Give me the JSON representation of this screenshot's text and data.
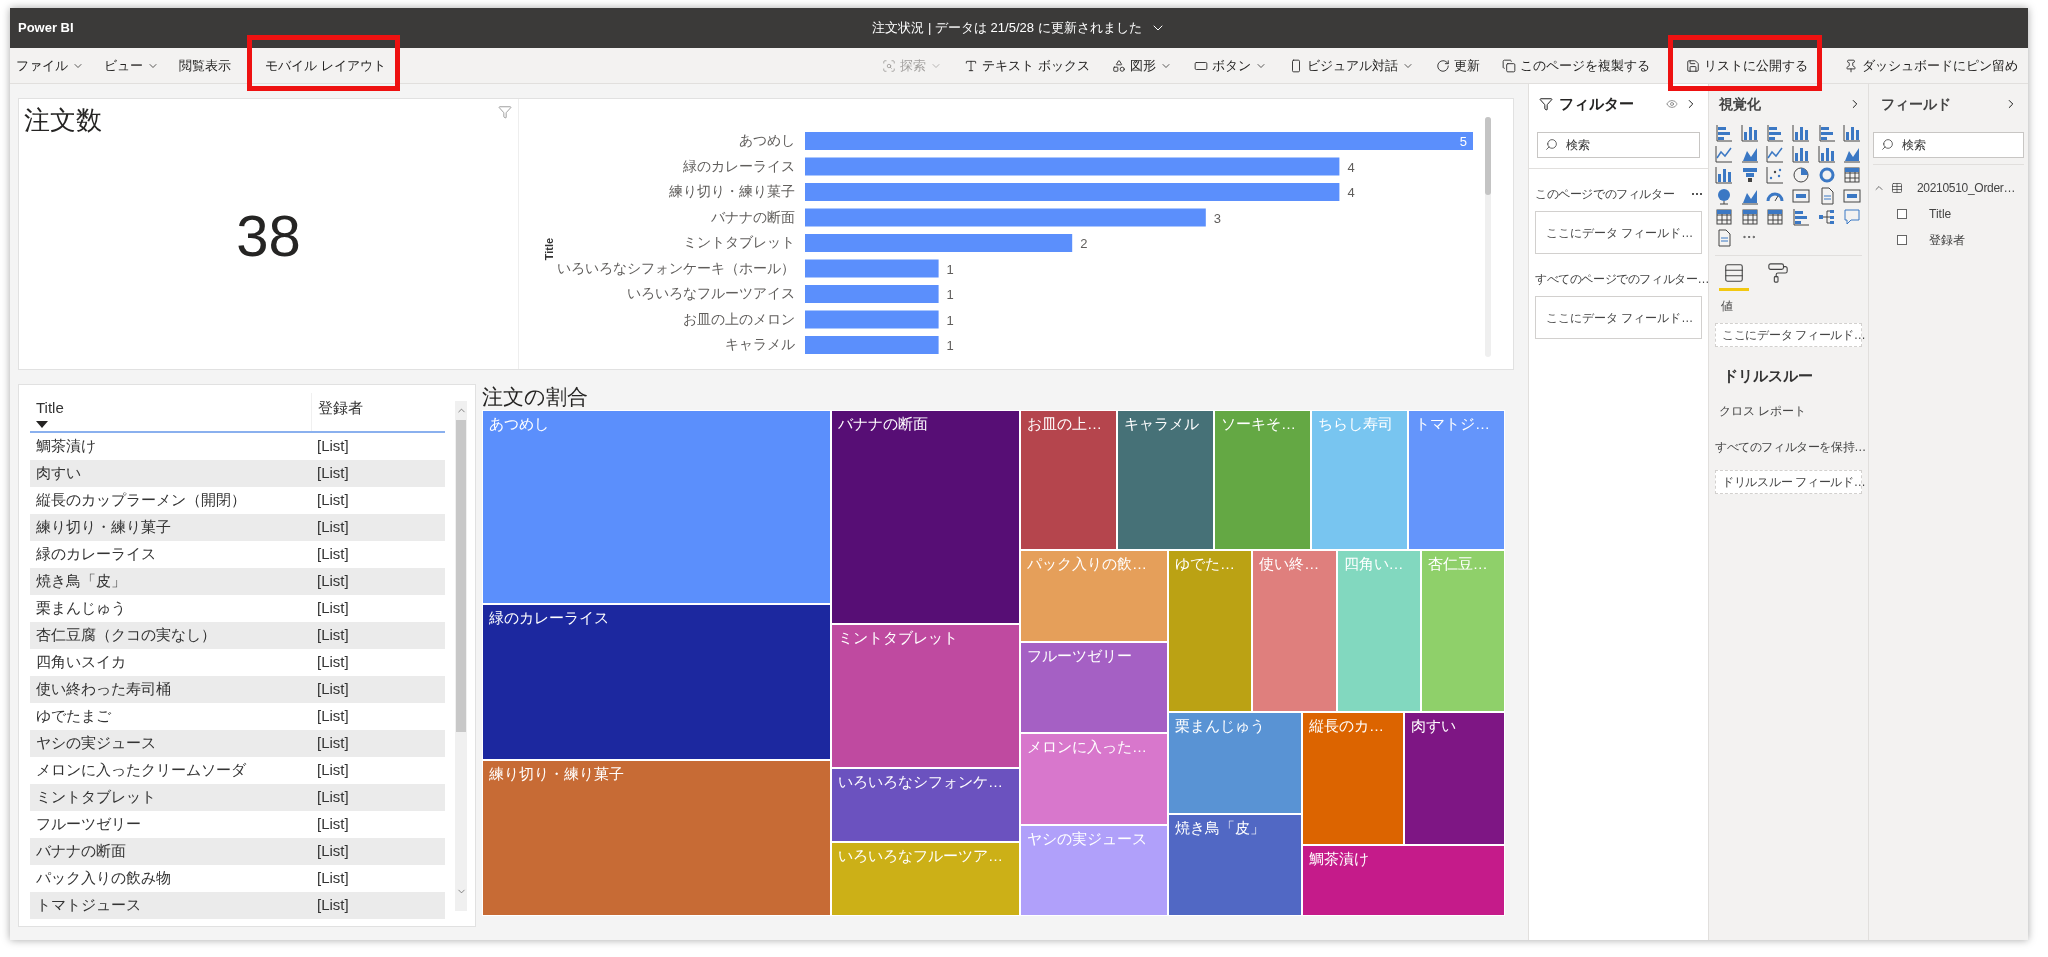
{
  "window": {
    "app_name": "Power BI",
    "title": "注文状況 | データは 21/5/28 に更新されました"
  },
  "menu": {
    "left": [
      {
        "label": "ファイル",
        "dropdown": true,
        "disabled": false,
        "highlighted": false
      },
      {
        "label": "ビュー",
        "dropdown": true,
        "disabled": false,
        "highlighted": false
      },
      {
        "label": "閲覧表示",
        "dropdown": false,
        "disabled": false,
        "highlighted": false
      },
      {
        "label": "モバイル レイアウト",
        "dropdown": false,
        "disabled": false,
        "highlighted": true
      }
    ],
    "right": [
      {
        "label": "探索",
        "dropdown": true,
        "disabled": true,
        "highlighted": false
      },
      {
        "label": "テキスト ボックス",
        "dropdown": false,
        "disabled": false,
        "highlighted": false
      },
      {
        "label": "図形",
        "dropdown": true,
        "disabled": false,
        "highlighted": false
      },
      {
        "label": "ボタン",
        "dropdown": true,
        "disabled": false,
        "highlighted": false
      },
      {
        "label": "ビジュアル対話",
        "dropdown": true,
        "disabled": false,
        "highlighted": false
      },
      {
        "label": "更新",
        "dropdown": false,
        "disabled": false,
        "highlighted": false
      },
      {
        "label": "このページを複製する",
        "dropdown": false,
        "disabled": false,
        "highlighted": false
      },
      {
        "label": "リストに公開する",
        "dropdown": false,
        "disabled": false,
        "highlighted": true
      },
      {
        "label": "ダッシュボードにピン留め",
        "dropdown": false,
        "disabled": false,
        "highlighted": false
      }
    ]
  },
  "card": {
    "title": "注文数",
    "value": "38"
  },
  "bar_chart": {
    "chart_data": {
      "type": "bar",
      "orientation": "horizontal",
      "ylabel": "Title",
      "categories": [
        "あつめし",
        "緑のカレーライス",
        "練り切り・練り菓子",
        "バナナの断面",
        "ミントタブレット",
        "いろいろなシフォンケーキ（ホール）",
        "いろいろなフルーツアイス",
        "お皿の上のメロン",
        "キャラメル"
      ],
      "values": [
        5,
        4,
        4,
        3,
        2,
        1,
        1,
        1,
        1
      ],
      "data_labels": true
    }
  },
  "table": {
    "columns": [
      {
        "label": "Title",
        "sorted": true
      },
      {
        "label": "登録者",
        "sorted": false
      }
    ],
    "rows": [
      [
        "鯛茶漬け",
        "[List]"
      ],
      [
        "肉すい",
        "[List]"
      ],
      [
        "縦長のカップラーメン（開閉）",
        "[List]"
      ],
      [
        "練り切り・練り菓子",
        "[List]"
      ],
      [
        "緑のカレーライス",
        "[List]"
      ],
      [
        "焼き鳥「皮」",
        "[List]"
      ],
      [
        "栗まんじゅう",
        "[List]"
      ],
      [
        "杏仁豆腐（クコの実なし）",
        "[List]"
      ],
      [
        "四角いスイカ",
        "[List]"
      ],
      [
        "使い終わった寿司桶",
        "[List]"
      ],
      [
        "ゆでたまご",
        "[List]"
      ],
      [
        "ヤシの実ジュース",
        "[List]"
      ],
      [
        "メロンに入ったクリームソーダ",
        "[List]"
      ],
      [
        "ミントタブレット",
        "[List]"
      ],
      [
        "フルーツゼリー",
        "[List]"
      ],
      [
        "バナナの断面",
        "[List]"
      ],
      [
        "パック入りの飲み物",
        "[List]"
      ],
      [
        "トマトジュース",
        "[List]"
      ]
    ]
  },
  "treemap": {
    "title": "注文の割合",
    "tiles": [
      {
        "label": "あつめし",
        "color": "#5b8ffc"
      },
      {
        "label": "緑のカレーライス",
        "color": "#1c289f"
      },
      {
        "label": "練り切り・練り菓子",
        "color": "#c76b35"
      },
      {
        "label": "バナナの断面",
        "color": "#570e75"
      },
      {
        "label": "ミントタブレット",
        "color": "#bf4aa0"
      },
      {
        "label": "いろいろなシフォンケ…",
        "color": "#6b52bf"
      },
      {
        "label": "いろいろなフルーツア…",
        "color": "#ccb017"
      },
      {
        "label": "お皿の上…",
        "color": "#b5454d"
      },
      {
        "label": "キャラメル",
        "color": "#467177"
      },
      {
        "label": "ソーキそ…",
        "color": "#64a844"
      },
      {
        "label": "ちらし寿司",
        "color": "#78c5f0"
      },
      {
        "label": "トマトジ…",
        "color": "#6495fb"
      },
      {
        "label": "パック入りの飲…",
        "color": "#e59f5a"
      },
      {
        "label": "フルーツゼリー",
        "color": "#a560c4"
      },
      {
        "label": "メロンに入った…",
        "color": "#d877cc"
      },
      {
        "label": "ヤシの実ジュース",
        "color": "#b0a0fa"
      },
      {
        "label": "ゆでた…",
        "color": "#bba214"
      },
      {
        "label": "使い終…",
        "color": "#df7f7d"
      },
      {
        "label": "四角い…",
        "color": "#82d8bf"
      },
      {
        "label": "杏仁豆…",
        "color": "#8fd06a"
      },
      {
        "label": "栗まんじゅう",
        "color": "#5993d4"
      },
      {
        "label": "焼き鳥「皮」",
        "color": "#5168c4"
      },
      {
        "label": "縦長のカ…",
        "color": "#dc6400"
      },
      {
        "label": "肉すい",
        "color": "#7e1684"
      },
      {
        "label": "鯛茶漬け",
        "color": "#c51b8a"
      }
    ]
  },
  "filters_pane": {
    "title": "フィルター",
    "search": {
      "placeholder": "検索"
    },
    "sections": [
      {
        "heading": "このページでのフィルター",
        "has_menu": true,
        "drop_zone": "ここにデータ フィールド…"
      },
      {
        "heading": "すべてのページでのフィルター…",
        "has_menu": false,
        "drop_zone": "ここにデータ フィールド…"
      }
    ]
  },
  "visualizations_pane": {
    "title": "視覚化",
    "tabs": [
      {
        "selected": true
      },
      {
        "selected": false
      }
    ],
    "well_label": "値",
    "well_drop_zone": "ここにデータ フィールド…",
    "drillthrough": {
      "title": "ドリルスルー",
      "cross_report": "クロス レポート",
      "keep_filters": "すべてのフィルターを保持…",
      "drop_zone": "ドリルスルー フィールド…"
    }
  },
  "fields_pane": {
    "title": "フィールド",
    "search": {
      "placeholder": "検索"
    },
    "tree": [
      {
        "label": "20210510_Order…",
        "expanded": true,
        "children": [
          {
            "label": "Title",
            "checked": false
          },
          {
            "label": "登録者",
            "checked": false
          }
        ]
      }
    ]
  }
}
